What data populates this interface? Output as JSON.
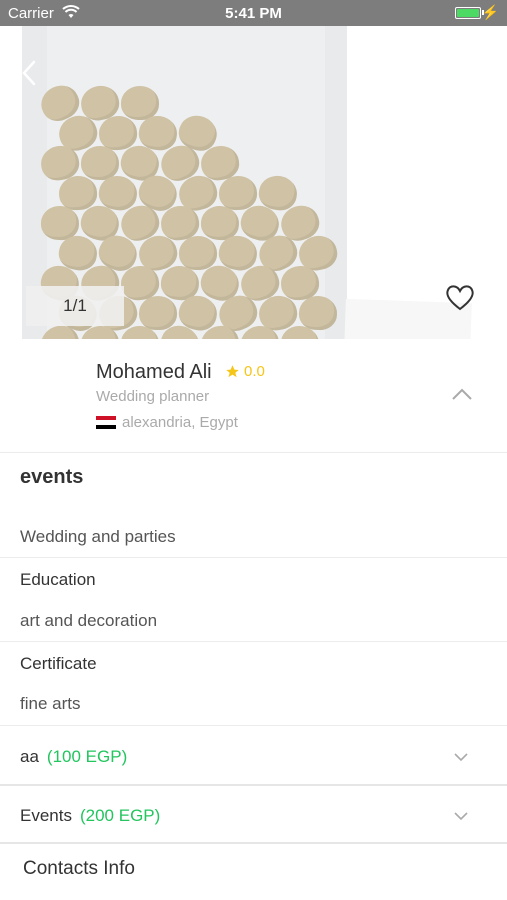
{
  "status_bar": {
    "carrier": "Carrier",
    "time": "5:41 PM",
    "battery_level": 1.0
  },
  "gallery": {
    "counter": "1/1"
  },
  "profile": {
    "name": "Mohamed Ali",
    "rating": "0.0",
    "role": "Wedding planner",
    "location": "alexandria, Egypt",
    "flag_icon": "egypt-flag-icon"
  },
  "details": {
    "events_title": "events",
    "events_value": "Wedding and parties",
    "education_label": "Education",
    "education_value": "art and decoration",
    "certificate_label": "Certificate",
    "certificate_value": "fine arts"
  },
  "packages": [
    {
      "name": "aa",
      "price": "(100 EGP)"
    },
    {
      "name": "Events",
      "price": "(200 EGP)"
    }
  ],
  "contacts_title": "Contacts Info",
  "colors": {
    "accent_green": "#22c55e",
    "star_yellow": "#f5c518",
    "muted_gray": "#aaaaaa"
  }
}
